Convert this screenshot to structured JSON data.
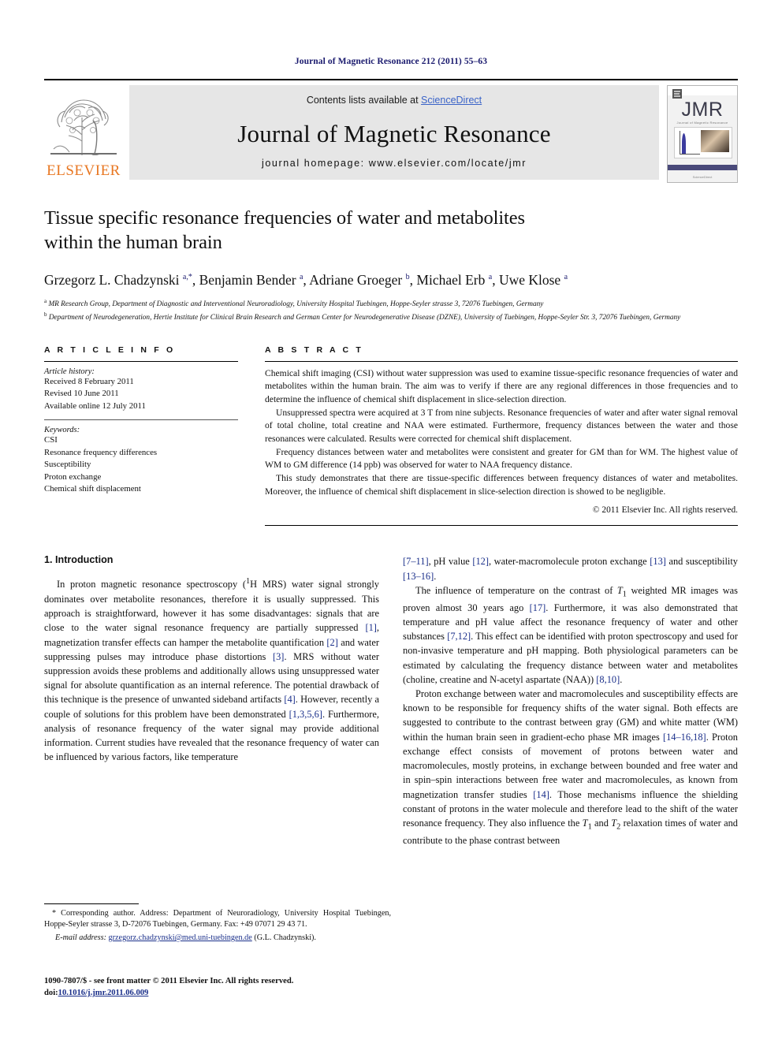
{
  "running_head": "Journal of Magnetic Resonance 212 (2011) 55–63",
  "masthead": {
    "publisher_logo_text": "ELSEVIER",
    "contents_prefix": "Contents lists available at ",
    "contents_link": "ScienceDirect",
    "journal_name": "Journal of Magnetic Resonance",
    "homepage": "journal homepage: www.elsevier.com/locate/jmr",
    "cover": {
      "title": "JMR",
      "subtitle": "Journal of Magnetic Resonance"
    },
    "link_color": "#3a63c8",
    "band_color": "#e6e6e6",
    "elsevier_orange": "#e87722"
  },
  "article": {
    "title_line1": "Tissue specific resonance frequencies of water and metabolites",
    "title_line2": "within the human brain",
    "authors_html": "Grzegorz L. Chadzynski <sup>a,*</sup>, Benjamin Bender <sup>a</sup>, Adriane Groeger <sup>b</sup>, Michael Erb <sup>a</sup>, Uwe Klose <sup>a</sup>",
    "affiliation_a": "MR Research Group, Department of Diagnostic and Interventional Neuroradiology, University Hospital Tuebingen, Hoppe-Seyler strasse 3, 72076 Tuebingen, Germany",
    "affiliation_b": "Department of Neurodegeneration, Hertie Institute for Clinical Brain Research and German Center for Neurodegenerative Disease (DZNE), University of Tuebingen, Hoppe-Seyler Str. 3, 72076 Tuebingen, Germany"
  },
  "article_info": {
    "heading": "A R T I C L E    I N F O",
    "history_label": "Article history:",
    "history": [
      "Received 8 February 2011",
      "Revised 10 June 2011",
      "Available online 12 July 2011"
    ],
    "keywords_label": "Keywords:",
    "keywords": [
      "CSI",
      "Resonance frequency differences",
      "Susceptibility",
      "Proton exchange",
      "Chemical shift displacement"
    ]
  },
  "abstract": {
    "heading": "A B S T R A C T",
    "paragraphs": [
      "Chemical shift imaging (CSI) without water suppression was used to examine tissue-specific resonance frequencies of water and metabolites within the human brain. The aim was to verify if there are any regional differences in those frequencies and to determine the influence of chemical shift displacement in slice-selection direction.",
      "Unsuppressed spectra were acquired at 3 T from nine subjects. Resonance frequencies of water and after water signal removal of total choline, total creatine and NAA were estimated. Furthermore, frequency distances between the water and those resonances were calculated. Results were corrected for chemical shift displacement.",
      "Frequency distances between water and metabolites were consistent and greater for GM than for WM. The highest value of WM to GM difference (14 ppb) was observed for water to NAA frequency distance.",
      "This study demonstrates that there are tissue-specific differences between frequency distances of water and metabolites. Moreover, the influence of chemical shift displacement in slice-selection direction is showed to be negligible."
    ],
    "copyright": "© 2011 Elsevier Inc. All rights reserved."
  },
  "introduction": {
    "heading": "1. Introduction",
    "left_paragraphs_html": [
      "In proton magnetic resonance spectroscopy (<sup>1</sup>H MRS) water signal strongly dominates over metabolite resonances, therefore it is usually suppressed. This approach is straightforward, however it has some disadvantages: signals that are close to the water signal resonance frequency are partially suppressed <span class=\"ref\">[1]</span>, magnetization transfer effects can hamper the metabolite quantification <span class=\"ref\">[2]</span> and water suppressing pulses may introduce phase distortions <span class=\"ref\">[3]</span>. MRS without water suppression avoids these problems and additionally allows using unsuppressed water signal for absolute quantification as an internal reference. The potential drawback of this technique is the presence of unwanted sideband artifacts <span class=\"ref\">[4]</span>. However, recently a couple of solutions for this problem have been demonstrated <span class=\"ref\">[1,3,5,6]</span>. Furthermore, analysis of resonance frequency of the water signal may provide additional information. Current studies have revealed that the resonance frequency of water can be influenced by various factors, like temperature"
    ],
    "right_paragraphs_html": [
      "<span class=\"ref\">[7–11]</span>, pH value <span class=\"ref\">[12]</span>, water-macromolecule proton exchange <span class=\"ref\">[13]</span> and susceptibility <span class=\"ref\">[13–16]</span>.",
      "The influence of temperature on the contrast of <i>T</i><sub>1</sub> weighted MR images was proven almost 30 years ago <span class=\"ref\">[17]</span>. Furthermore, it was also demonstrated that temperature and pH value affect the resonance frequency of water and other substances <span class=\"ref\">[7,12]</span>. This effect can be identified with proton spectroscopy and used for non-invasive temperature and pH mapping. Both physiological parameters can be estimated by calculating the frequency distance between water and metabolites (choline, creatine and N-acetyl aspartate (NAA)) <span class=\"ref\">[8,10]</span>.",
      "Proton exchange between water and macromolecules and susceptibility effects are known to be responsible for frequency shifts of the water signal. Both effects are suggested to contribute to the contrast between gray (GM) and white matter (WM) within the human brain seen in gradient-echo phase MR images <span class=\"ref\">[14–16,18]</span>. Proton exchange effect consists of movement of protons between water and macromolecules, mostly proteins, in exchange between bounded and free water and in spin–spin interactions between free water and macromolecules, as known from magnetization transfer studies <span class=\"ref\">[14]</span>. Those mechanisms influence the shielding constant of protons in the water molecule and therefore lead to the shift of the water resonance frequency. They also influence the <i>T</i><sub>1</sub> and <i>T</i><sub>2</sub> relaxation times of water and contribute to the phase contrast between"
    ]
  },
  "footnote": {
    "corresponding_html": "* Corresponding author. Address: Department of Neuroradiology, University Hospital Tuebingen, Hoppe-Seyler strasse 3, D-72076 Tuebingen, Germany. Fax: +49 07071 29 43 71.",
    "email_label": "E-mail address:",
    "email": "grzegorz.chadzynski@med.uni-tuebingen.de",
    "email_owner": "(G.L. Chadzynski)."
  },
  "footer": {
    "issn_line": "1090-7807/$ - see front matter © 2011 Elsevier Inc. All rights reserved.",
    "doi_label": "doi:",
    "doi": "10.1016/j.jmr.2011.06.009"
  }
}
